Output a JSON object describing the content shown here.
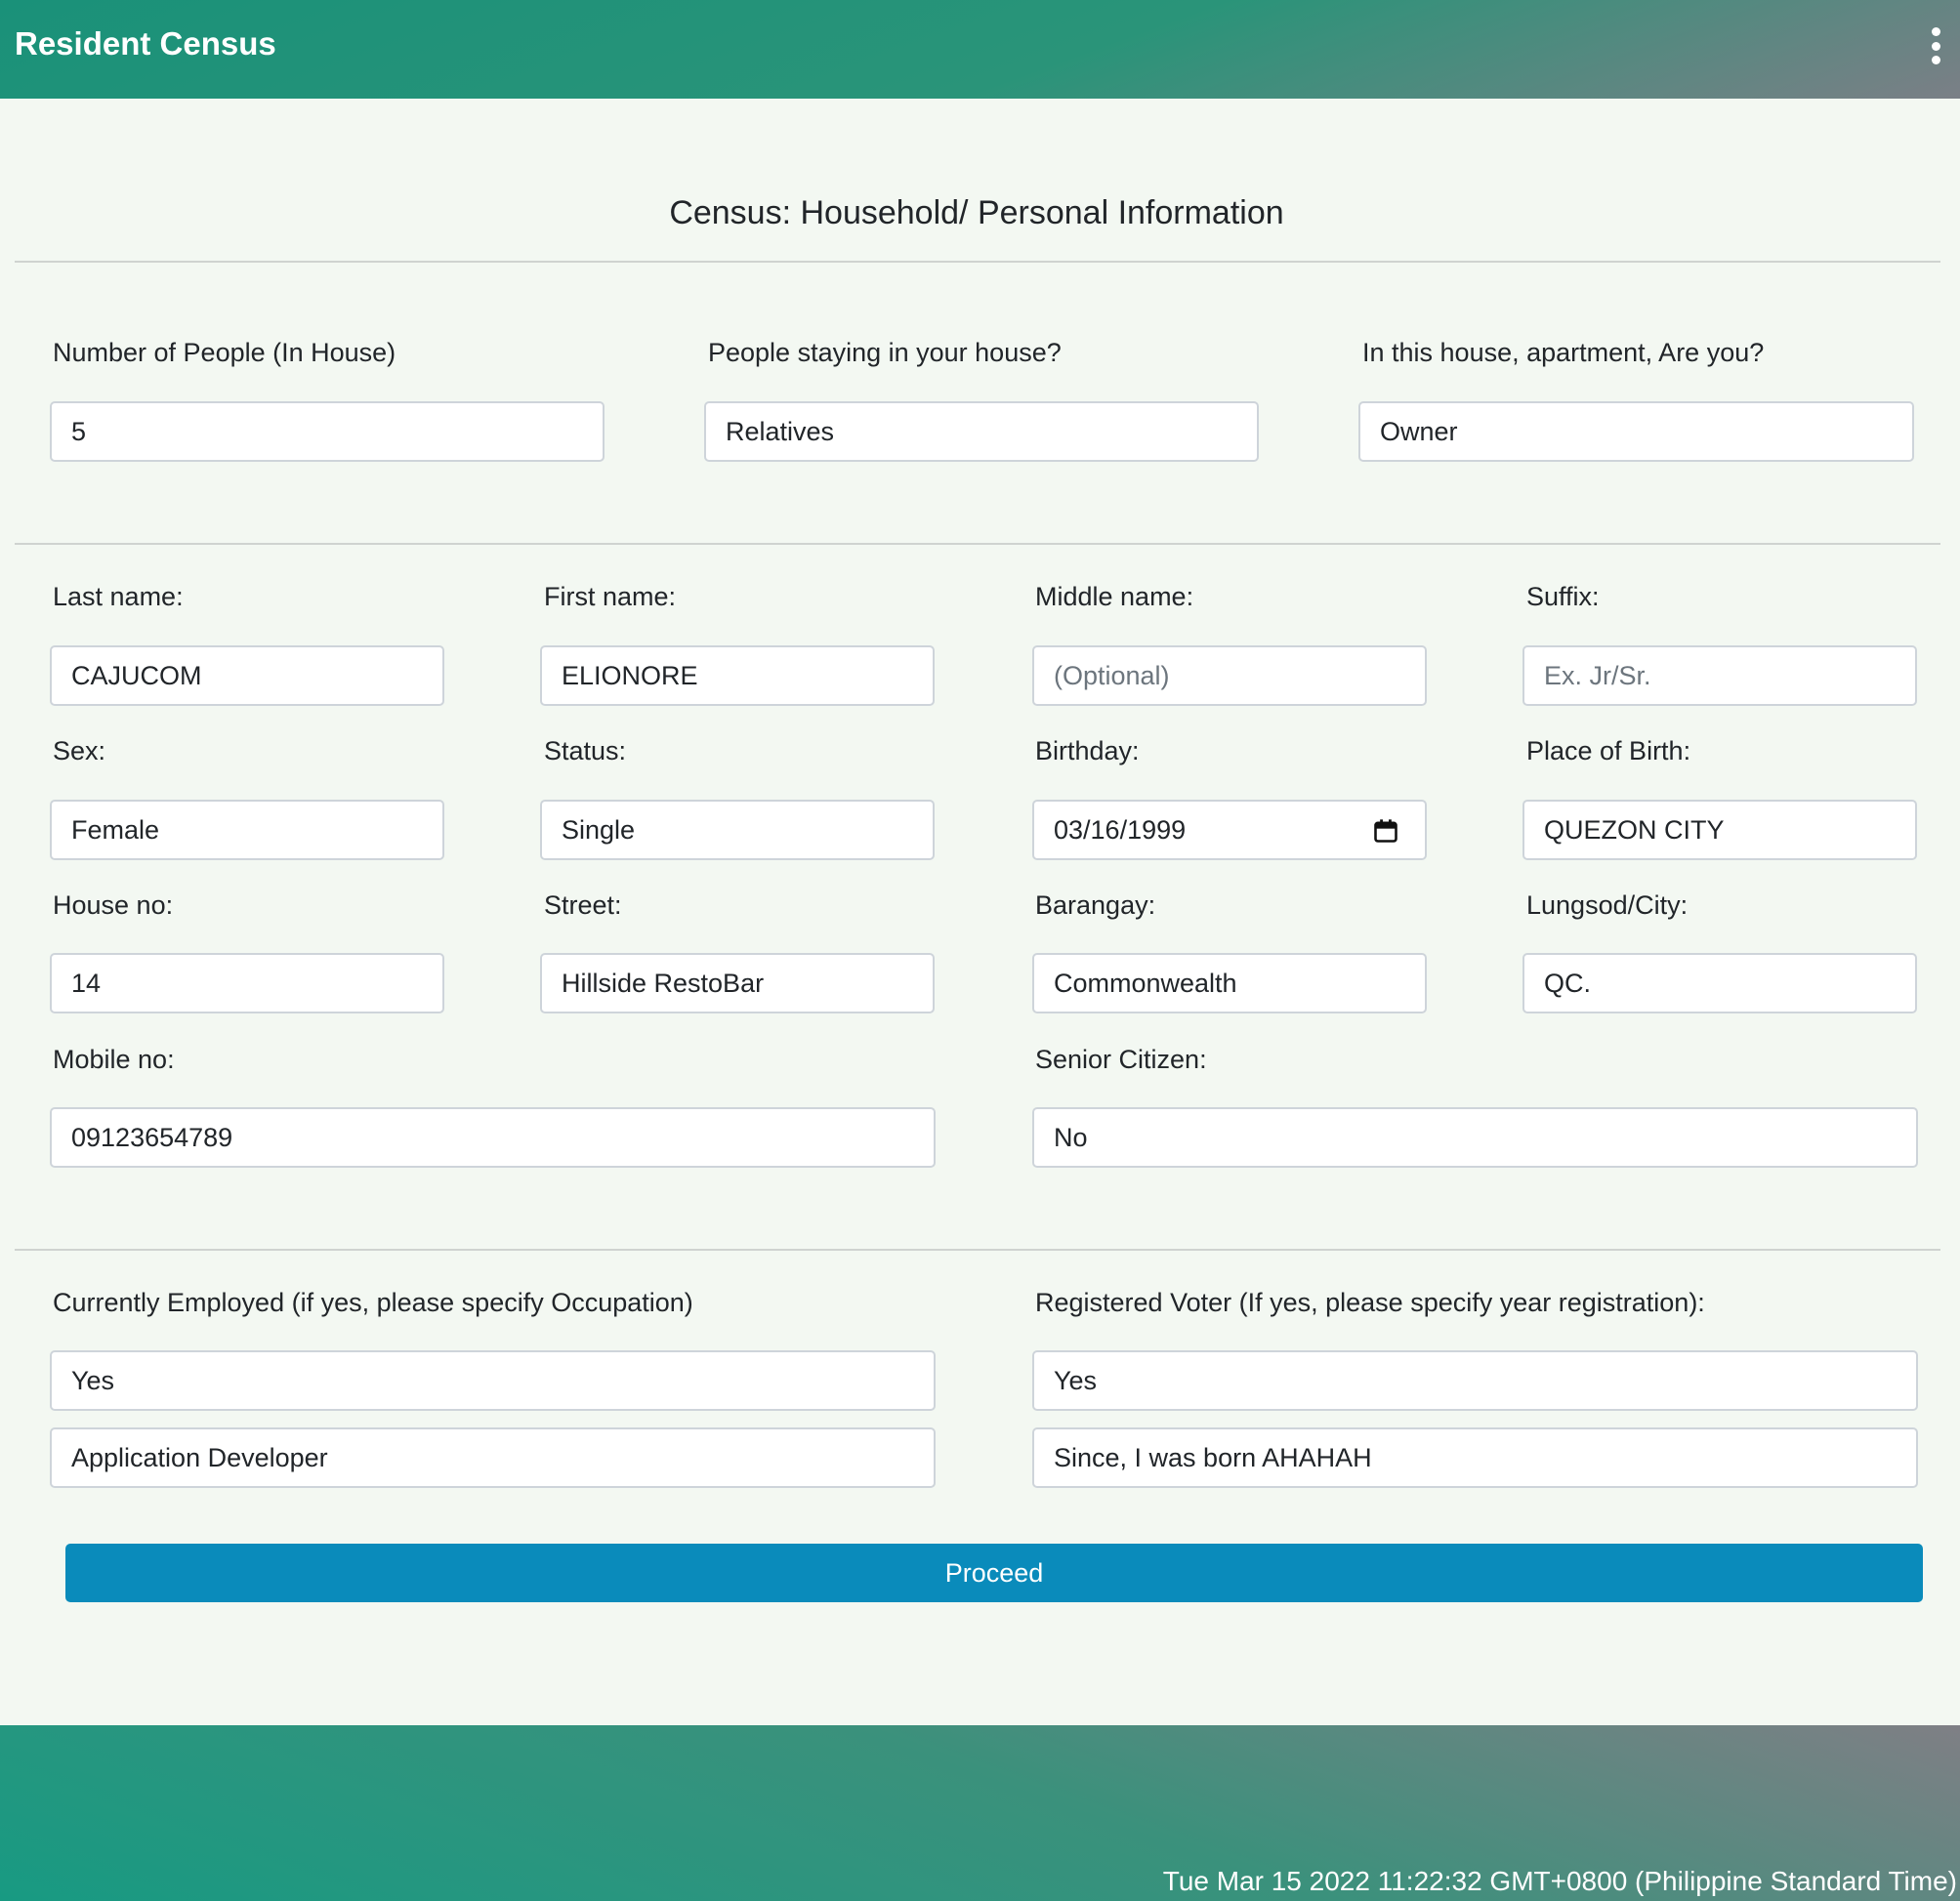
{
  "header": {
    "title": "Resident Census",
    "menu_icon": "kebab-menu-icon"
  },
  "form": {
    "title": "Census: Household/ Personal Information",
    "household": {
      "people_count": {
        "label": "Number of People (In House)",
        "value": "5"
      },
      "people_staying": {
        "label": "People staying in your house?",
        "value": "Relatives"
      },
      "house_role": {
        "label": "In this house, apartment, Are you?",
        "value": "Owner"
      }
    },
    "personal": {
      "last_name": {
        "label": "Last name:",
        "value": "CAJUCOM"
      },
      "first_name": {
        "label": "First name:",
        "value": "ELIONORE"
      },
      "middle_name": {
        "label": "Middle name:",
        "value": "",
        "placeholder": "(Optional)"
      },
      "suffix": {
        "label": "Suffix:",
        "value": "",
        "placeholder": "Ex. Jr/Sr."
      },
      "sex": {
        "label": "Sex:",
        "value": "Female"
      },
      "status": {
        "label": "Status:",
        "value": "Single"
      },
      "birthday": {
        "label": "Birthday:",
        "value": "03/16/1999"
      },
      "place_of_birth": {
        "label": "Place of Birth:",
        "value": "QUEZON CITY"
      },
      "house_no": {
        "label": "House no:",
        "value": "14"
      },
      "street": {
        "label": "Street:",
        "value": "Hillside RestoBar"
      },
      "barangay": {
        "label": "Barangay:",
        "value": "Commonwealth"
      },
      "city": {
        "label": "Lungsod/City:",
        "value": "QC."
      },
      "mobile": {
        "label": "Mobile no:",
        "value": "09123654789"
      },
      "senior": {
        "label": "Senior Citizen:",
        "value": "No"
      }
    },
    "employment": {
      "label": "Currently Employed (if yes, please specify Occupation)",
      "value": "Yes",
      "occupation": "Application Developer"
    },
    "voter": {
      "label": "Registered Voter (If yes, please specify year registration):",
      "value": "Yes",
      "year": "Since, I was born AHAHAH"
    },
    "proceed_label": "Proceed"
  },
  "footer": {
    "timestamp": "Tue Mar 15 2022 11:22:32 GMT+0800 (Philippine Standard Time)"
  },
  "colors": {
    "primary_button": "#0a8bbb",
    "header_green": "#1a9179"
  }
}
